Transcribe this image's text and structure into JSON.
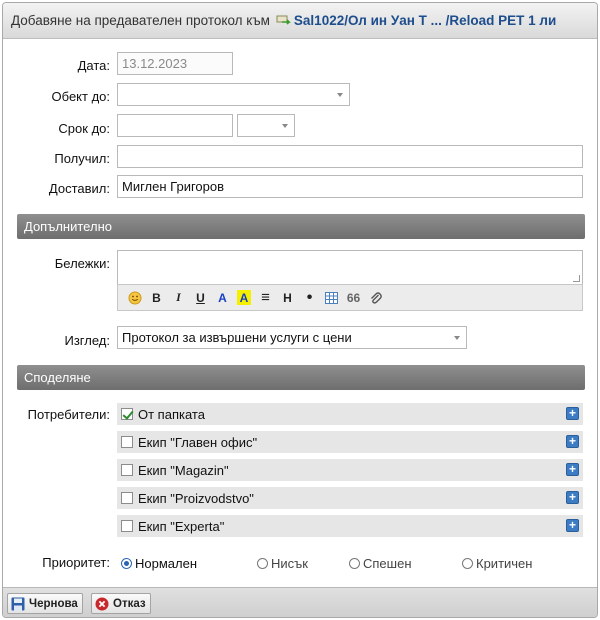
{
  "title": {
    "prefix": "Добавяне на предавателен протокол към",
    "link": "Sal1022/Ол ин Уан Т ... /Reload PET 1 ли"
  },
  "form": {
    "date": {
      "label": "Дата:",
      "value": "13.12.2023"
    },
    "object": {
      "label": "Обект до:",
      "value": ""
    },
    "deadline": {
      "label": "Срок до:",
      "date_value": "",
      "time_value": ""
    },
    "recipient": {
      "label": "Получил:",
      "value": ""
    },
    "deliverer": {
      "label": "Доставил:",
      "value": "Миглен Григоров"
    }
  },
  "sections": {
    "additional": "Допълнително",
    "sharing": "Споделяне"
  },
  "notes": {
    "label": "Бележки:",
    "value": "",
    "toolbar": [
      {
        "name": "smiley-icon",
        "glyph": "☺"
      },
      {
        "name": "bold-icon",
        "glyph": "B"
      },
      {
        "name": "italic-icon",
        "glyph": "I"
      },
      {
        "name": "underline-icon",
        "glyph": "U"
      },
      {
        "name": "text-color-icon",
        "glyph": "A"
      },
      {
        "name": "highlight-icon",
        "glyph": "A"
      },
      {
        "name": "align-icon",
        "glyph": "≡"
      },
      {
        "name": "heading-icon",
        "glyph": "H"
      },
      {
        "name": "bullet-list-icon",
        "glyph": "•"
      },
      {
        "name": "table-icon",
        "glyph": "▦"
      },
      {
        "name": "quote-icon",
        "glyph": "66"
      },
      {
        "name": "attachment-icon",
        "glyph": "⊘"
      }
    ]
  },
  "view": {
    "label": "Изглед:",
    "selected": "Протокол за извършени услуги с цени"
  },
  "sharing": {
    "label": "Потребители:",
    "items": [
      {
        "label": "От папката",
        "checked": true
      },
      {
        "label": "Екип \"Главен офис\"",
        "checked": false
      },
      {
        "label": "Екип \"Magazin\"",
        "checked": false
      },
      {
        "label": "Екип \"Proizvodstvo\"",
        "checked": false
      },
      {
        "label": "Екип \"Experta\"",
        "checked": false
      }
    ]
  },
  "priority": {
    "label": "Приоритет:",
    "options": [
      {
        "label": "Нормален",
        "selected": true
      },
      {
        "label": "Нисък",
        "selected": false
      },
      {
        "label": "Спешен",
        "selected": false
      },
      {
        "label": "Критичен",
        "selected": false
      }
    ]
  },
  "buttons": {
    "draft": "Чернова",
    "cancel": "Отказ"
  },
  "colors": {
    "link": "#1d4d8c",
    "section_bar": "#7d7d7d",
    "plus_button": "#3b7cc4",
    "radio_selected": "#2c64b4"
  }
}
